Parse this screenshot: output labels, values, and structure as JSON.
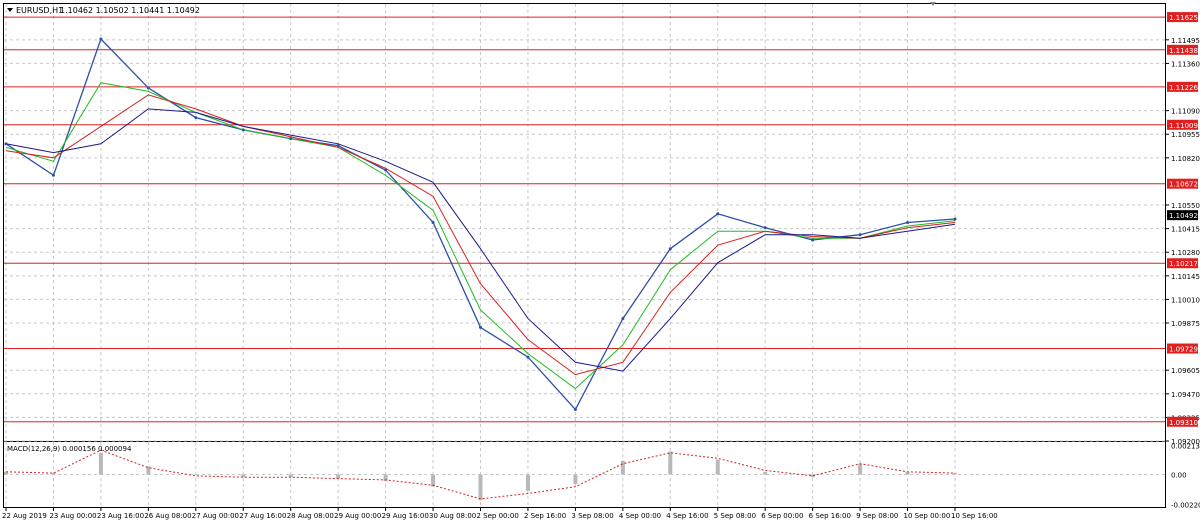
{
  "header": {
    "symbol_label": "EURUSD,H1",
    "ohlc_label": "1.10462 1.10502 1.10441 1.10492"
  },
  "indicator": {
    "label": "MACD(12,26,9) 0.000156 0.000094",
    "axis_labels": [
      "0.002134",
      "0.00",
      "-0.002205"
    ]
  },
  "price_axis": {
    "labels": [
      "1.11495",
      "1.11360",
      "1.11090",
      "1.10955",
      "1.10820",
      "1.10550",
      "1.10415",
      "1.10280",
      "1.10145",
      "1.10010",
      "1.09875",
      "1.09605",
      "1.09470",
      "1.09335",
      "1.09200"
    ],
    "current_price": "1.10492"
  },
  "levels": [
    "1.11625",
    "1.11438",
    "1.11226",
    "1.11009",
    "1.10672",
    "1.10217",
    "1.09729",
    "1.09310"
  ],
  "time_axis": {
    "labels": [
      "22 Aug 2019",
      "23 Aug 00:00",
      "23 Aug 16:00",
      "26 Aug 08:00",
      "27 Aug 00:00",
      "27 Aug 16:00",
      "28 Aug 08:00",
      "29 Aug 00:00",
      "29 Aug 16:00",
      "30 Aug 08:00",
      "2 Sep 00:00",
      "2 Sep 16:00",
      "3 Sep 08:00",
      "4 Sep 00:00",
      "4 Sep 16:00",
      "5 Sep 08:00",
      "6 Sep 00:00",
      "6 Sep 16:00",
      "9 Sep 08:00",
      "10 Sep 00:00",
      "10 Sep 16:00"
    ]
  },
  "colors": {
    "level_line": "#e02020",
    "level_label_bg": "#e02020",
    "price_bars": "#2c4fa8",
    "ma_fast": "#22bb22",
    "ma_mid": "#d82020",
    "ma_slow": "#1a1a8c",
    "signal": "#d82020",
    "histogram": "#b8b8b8",
    "current_price_bg": "#000000"
  },
  "chart_data": {
    "type": "line",
    "xlabel": "",
    "ylabel": "",
    "ylim": [
      1.092,
      1.117
    ],
    "x": [
      "22 Aug 2019",
      "23 Aug 00:00",
      "23 Aug 16:00",
      "26 Aug 08:00",
      "27 Aug 00:00",
      "27 Aug 16:00",
      "28 Aug 08:00",
      "29 Aug 00:00",
      "29 Aug 16:00",
      "30 Aug 08:00",
      "2 Sep 00:00",
      "2 Sep 16:00",
      "3 Sep 08:00",
      "4 Sep 00:00",
      "4 Sep 16:00",
      "5 Sep 08:00",
      "6 Sep 00:00",
      "6 Sep 16:00",
      "9 Sep 08:00",
      "10 Sep 00:00",
      "10 Sep 16:00"
    ],
    "series": [
      {
        "values": [
          1.109,
          1.1072,
          1.115,
          1.1122,
          1.1105,
          1.1098,
          1.1093,
          1.1089,
          1.1075,
          1.1045,
          1.0985,
          1.0968,
          1.0938,
          1.099,
          1.103,
          1.105,
          1.1042,
          1.1035,
          1.1038,
          1.1045,
          1.1047
        ]
      },
      {
        "values": [
          1.1088,
          1.108,
          1.1125,
          1.112,
          1.1108,
          1.1098,
          1.1093,
          1.1088,
          1.1072,
          1.1052,
          1.0995,
          1.097,
          1.095,
          1.0975,
          1.1018,
          1.104,
          1.104,
          1.1036,
          1.1036,
          1.1043,
          1.1046
        ]
      },
      {
        "values": [
          1.1086,
          1.1082,
          1.11,
          1.1118,
          1.111,
          1.11,
          1.1094,
          1.1088,
          1.1076,
          1.106,
          1.101,
          1.0978,
          1.0958,
          1.0965,
          1.1005,
          1.1032,
          1.104,
          1.1037,
          1.1036,
          1.1042,
          1.1045
        ]
      },
      {
        "values": [
          1.109,
          1.1085,
          1.109,
          1.111,
          1.1108,
          1.11,
          1.1095,
          1.109,
          1.108,
          1.1068,
          1.103,
          1.099,
          1.0965,
          1.096,
          1.099,
          1.1022,
          1.1038,
          1.1038,
          1.1036,
          1.104,
          1.1044
        ]
      }
    ],
    "macd_signal": [
      0.0002,
      0.0001,
      0.0018,
      0.0005,
      -0.0001,
      -0.0002,
      -0.0002,
      -0.0003,
      -0.0004,
      -0.0008,
      -0.0018,
      -0.0014,
      -0.0009,
      0.0008,
      0.0016,
      0.0012,
      0.0003,
      -0.0001,
      0.0008,
      0.0002,
      0.0001
    ],
    "macd_hist": [
      0.0002,
      0.0001,
      0.0016,
      0.0006,
      0.0,
      -0.0002,
      -0.0002,
      -0.0003,
      -0.0005,
      -0.0009,
      -0.0019,
      -0.0012,
      -0.0007,
      0.001,
      0.0017,
      0.0011,
      0.0002,
      -0.0002,
      0.0008,
      0.0002,
      0.0001
    ]
  }
}
